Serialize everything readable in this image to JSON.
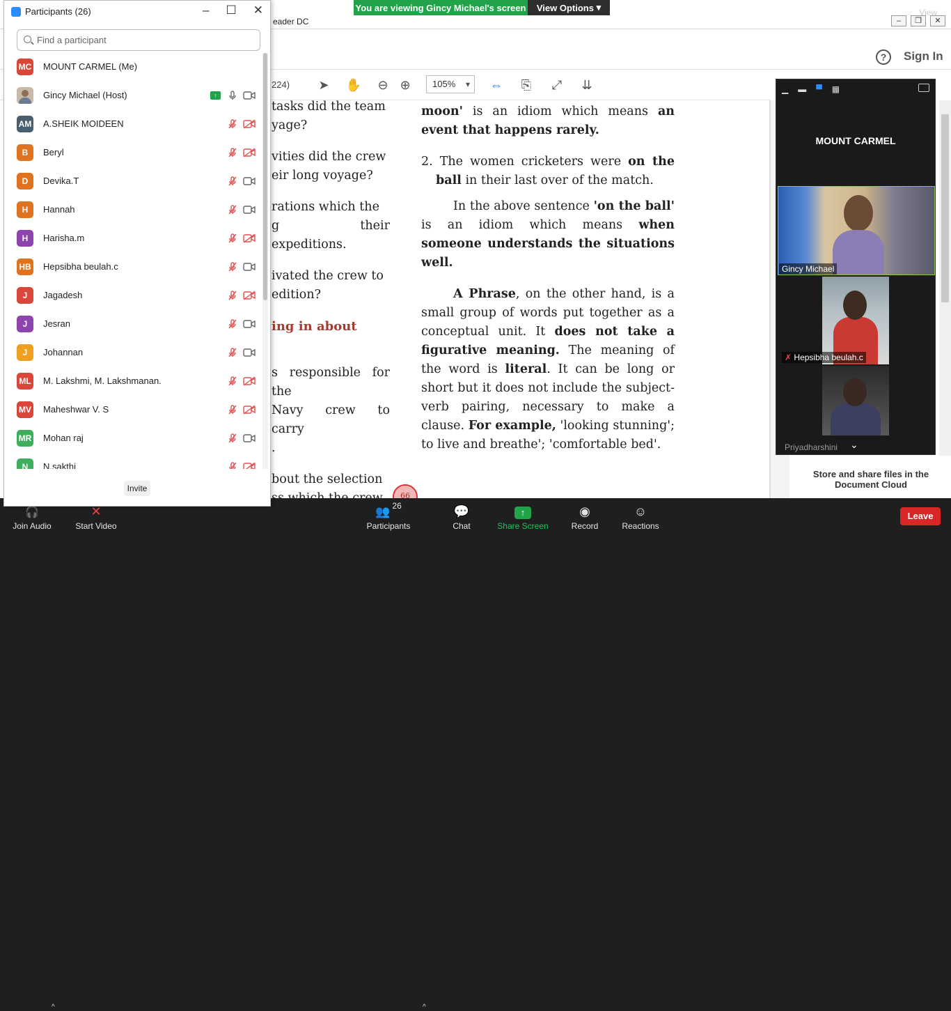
{
  "banner": {
    "viewing": "You are viewing Gincy Michael's screen",
    "view_options": "View Options"
  },
  "acrobat": {
    "title_fragment": "eader DC",
    "sign_in": "Sign In",
    "page_count": "224)",
    "zoom": "105%",
    "store_text": "Store and share files in the Document Cloud",
    "top_view_label": "View"
  },
  "document": {
    "left_lines": [
      "tasks did the team\nyage?",
      "vities did the crew\neir long voyage?",
      "rations which the\ng their expeditions.",
      "ivated the crew to\nedition?",
      "s responsible for the\nNavy crew to carry\n.",
      "bout the selection\nss which the crew"
    ],
    "left_heading": "ing in about",
    "right": {
      "p1_bold_start": "moon'",
      "p1_text": " is an idiom which means ",
      "p1_bold_end": "an event that happens rarely.",
      "p2_num": "2. The women cricketers were ",
      "p2_bold": "on the ball",
      "p2_text": " in their last over of the match.",
      "p3_text": "In the above sentence ",
      "p3_bold": "'on the ball'",
      "p3_text2": " is an idiom which means ",
      "p3_bold2": "when someone understands the situations well.",
      "p4_bold": "A Phrase",
      "p4_t1": ", on the other hand, is a small group of words put together as a conceptual unit. It ",
      "p4_b2": "does not take a figurative meaning.",
      "p4_t2": " The meaning of the word is ",
      "p4_b3": "literal",
      "p4_t3": ". It can be long or short but it does not include the subject-verb pairing, necessary to make a clause. ",
      "p4_b4": "For example,",
      "p4_t4": " 'looking stunning'; to live and breathe'; 'comfortable bed'."
    },
    "page_number": "66"
  },
  "participants": {
    "title": "Participants (26)",
    "search_placeholder": "Find a participant",
    "invite": "Invite",
    "list": [
      {
        "initials": "MC",
        "name": "MOUNT CARMEL (Me)",
        "color": "#d9473a",
        "mic": "none",
        "cam": "none"
      },
      {
        "initials": "",
        "name": "Gincy Michael (Host)",
        "color": "photo",
        "mic": "on",
        "cam": "on",
        "sharing": true
      },
      {
        "initials": "AM",
        "name": "A.SHEIK MOIDEEN",
        "color": "#4a5e6d",
        "mic": "muted",
        "cam": "off"
      },
      {
        "initials": "B",
        "name": "Beryl",
        "color": "#e0731f",
        "mic": "muted",
        "cam": "off"
      },
      {
        "initials": "D",
        "name": "Devika.T",
        "color": "#e0731f",
        "mic": "muted",
        "cam": "on"
      },
      {
        "initials": "H",
        "name": "Hannah",
        "color": "#e0731f",
        "mic": "muted",
        "cam": "on"
      },
      {
        "initials": "H",
        "name": "Harisha.m",
        "color": "#8e44ad",
        "mic": "muted",
        "cam": "off"
      },
      {
        "initials": "HB",
        "name": "Hepsibha beulah.c",
        "color": "#e0731f",
        "mic": "muted",
        "cam": "on"
      },
      {
        "initials": "J",
        "name": "Jagadesh",
        "color": "#d9473a",
        "mic": "muted",
        "cam": "off"
      },
      {
        "initials": "J",
        "name": "Jesran",
        "color": "#8e44ad",
        "mic": "muted",
        "cam": "on"
      },
      {
        "initials": "J",
        "name": "Johannan",
        "color": "#f0a020",
        "mic": "muted",
        "cam": "on"
      },
      {
        "initials": "ML",
        "name": "M. Lakshmi, M. Lakshmanan.",
        "color": "#d9473a",
        "mic": "muted",
        "cam": "off"
      },
      {
        "initials": "MV",
        "name": "Maheshwar V. S",
        "color": "#d9473a",
        "mic": "muted",
        "cam": "off"
      },
      {
        "initials": "MR",
        "name": "Mohan raj",
        "color": "#3cae5c",
        "mic": "muted",
        "cam": "on"
      },
      {
        "initials": "N",
        "name": "N.sakthi",
        "color": "#3cae5c",
        "mic": "muted",
        "cam": "off"
      }
    ]
  },
  "video": {
    "self_name": "MOUNT CARMEL",
    "tiles": [
      {
        "name": "Gincy Michael"
      },
      {
        "name": "Hepsibha beulah.c"
      },
      {
        "name": "Priyadharshini"
      }
    ]
  },
  "toolbar": {
    "join_audio": "Join Audio",
    "start_video": "Start Video",
    "participants": "Participants",
    "participants_count": "26",
    "chat": "Chat",
    "share_screen": "Share Screen",
    "record": "Record",
    "reactions": "Reactions",
    "leave": "Leave"
  },
  "colors": {
    "zoom_green": "#21a34a",
    "leave_red": "#d92626",
    "accent_blue": "#2d8cff"
  }
}
